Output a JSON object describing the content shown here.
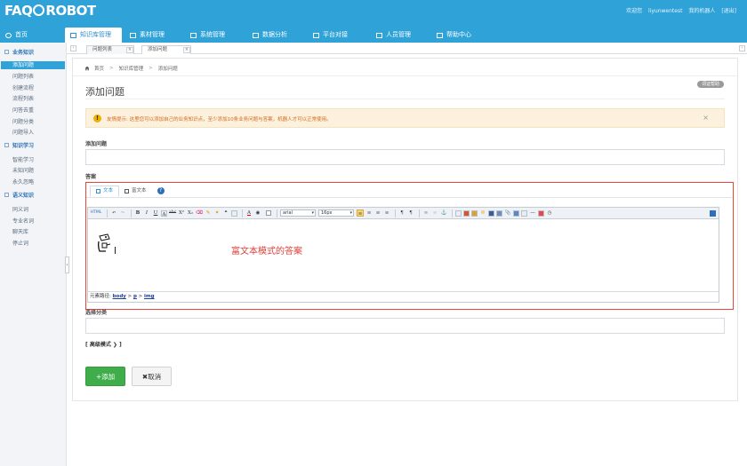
{
  "header": {
    "logo": "FAQ ROBOT",
    "welcome": "欢迎您",
    "username": "liyunwentest",
    "my_robot": "我的机器人",
    "logout": "[退出]"
  },
  "nav": {
    "items": [
      {
        "label": "首页"
      },
      {
        "label": "知识库管理"
      },
      {
        "label": "素材管理"
      },
      {
        "label": "系统管理"
      },
      {
        "label": "数据分析"
      },
      {
        "label": "平台对接"
      },
      {
        "label": "人员管理"
      },
      {
        "label": "帮助中心"
      }
    ]
  },
  "sidebar": {
    "sections": [
      {
        "title": "业务知识",
        "items": [
          "添加问题",
          "问题列表",
          "创建流程",
          "流程列表",
          "问答去重",
          "问题分类",
          "问题导入"
        ]
      },
      {
        "title": "知识学习",
        "items": [
          "智能学习",
          "未知问题",
          "永久忽略"
        ]
      },
      {
        "title": "语义知识",
        "items": [
          "同义词",
          "专业名词",
          "聊天库",
          "停止词"
        ]
      }
    ]
  },
  "tabs": {
    "items": [
      "问题列表",
      "添加问题"
    ],
    "close": "×",
    "prev": "‹",
    "next": "›"
  },
  "breadcrumb": {
    "home": "首页",
    "sep": ">",
    "level1": "知识库管理",
    "level2": "添加问题"
  },
  "page": {
    "title": "添加问题",
    "help_badge": "词证帮助",
    "notice_text": "友情提示: 这里您可以添加自己的业务知识点，至少添加10条业务问题与答案，机器人才可以正常使用。",
    "notice_close": "×",
    "question_label": "添加问题",
    "answer_label": "答案",
    "category_label": "选择分类",
    "advanced_mode": "[ 高级模式 ❯ ]",
    "add_button": "+添加",
    "cancel_button": "✖取消"
  },
  "editor": {
    "tabs": [
      "文本",
      "富文本"
    ],
    "help": "?",
    "source_button": "HTML",
    "font_family": "arial",
    "font_size": "16px",
    "sample_text": "富文本模式的答案",
    "status_prefix": "元素路径: ",
    "path": [
      "body",
      "p",
      "img"
    ],
    "path_sep": " > "
  },
  "colors": {
    "brand_blue": "#2fa2d8",
    "highlight_red": "#e8443a",
    "add_green": "#3fae4a",
    "notice_orange": "#d8671c"
  }
}
